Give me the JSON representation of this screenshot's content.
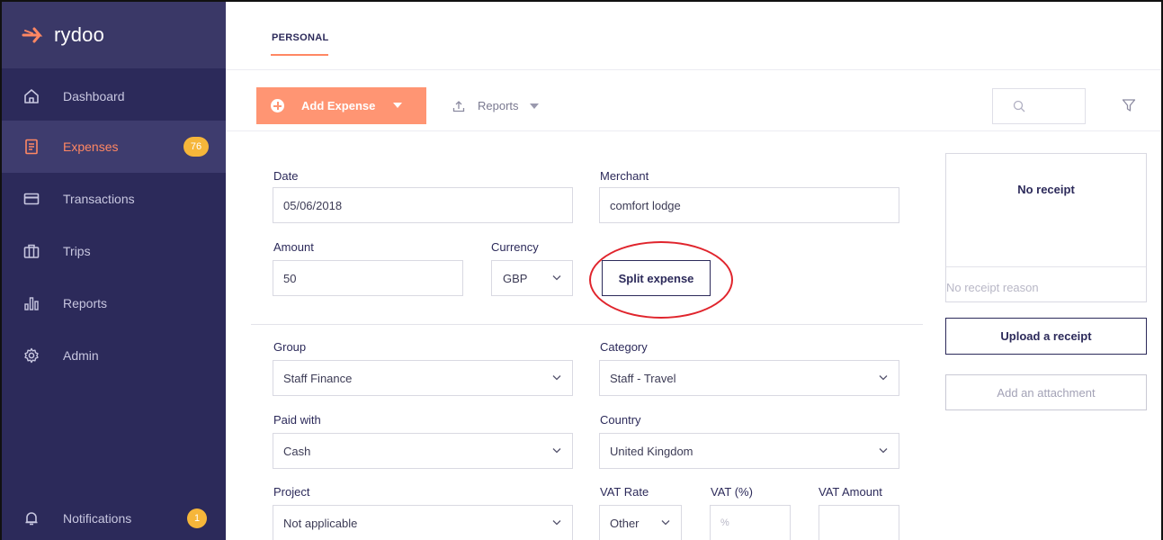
{
  "brand": {
    "name": "rydoo",
    "accent": "#ff8763",
    "sidebar_bg": "#2c2a5a"
  },
  "sidebar": {
    "items": [
      {
        "label": "Dashboard",
        "icon": "home-icon"
      },
      {
        "label": "Expenses",
        "icon": "receipt-icon",
        "badge": "76",
        "active": true
      },
      {
        "label": "Transactions",
        "icon": "card-icon"
      },
      {
        "label": "Trips",
        "icon": "suitcase-icon"
      },
      {
        "label": "Reports",
        "icon": "bar-chart-icon"
      },
      {
        "label": "Admin",
        "icon": "gear-icon"
      }
    ],
    "notifications": {
      "label": "Notifications",
      "icon": "bell-icon",
      "badge": "1"
    }
  },
  "tabs": {
    "personal": "PERSONAL"
  },
  "toolbar": {
    "add_expense": "Add Expense",
    "reports": "Reports"
  },
  "form": {
    "date": {
      "label": "Date",
      "value": "05/06/2018"
    },
    "merchant": {
      "label": "Merchant",
      "value": "comfort lodge"
    },
    "amount": {
      "label": "Amount",
      "value": "50"
    },
    "currency": {
      "label": "Currency",
      "value": "GBP"
    },
    "split_expense": "Split expense",
    "group": {
      "label": "Group",
      "value": "Staff Finance"
    },
    "category": {
      "label": "Category",
      "value": "Staff - Travel"
    },
    "paid_with": {
      "label": "Paid with",
      "value": "Cash"
    },
    "country": {
      "label": "Country",
      "value": "United Kingdom"
    },
    "project": {
      "label": "Project",
      "value": "Not applicable"
    },
    "vat_rate": {
      "label": "VAT Rate",
      "value": "Other"
    },
    "vat_percent": {
      "label": "VAT (%)",
      "placeholder": "%"
    },
    "vat_amount": {
      "label": "VAT Amount",
      "value": ""
    }
  },
  "receipt": {
    "title": "No receipt",
    "reason_placeholder": "No receipt reason",
    "upload": "Upload a receipt",
    "attach": "Add an attachment"
  }
}
